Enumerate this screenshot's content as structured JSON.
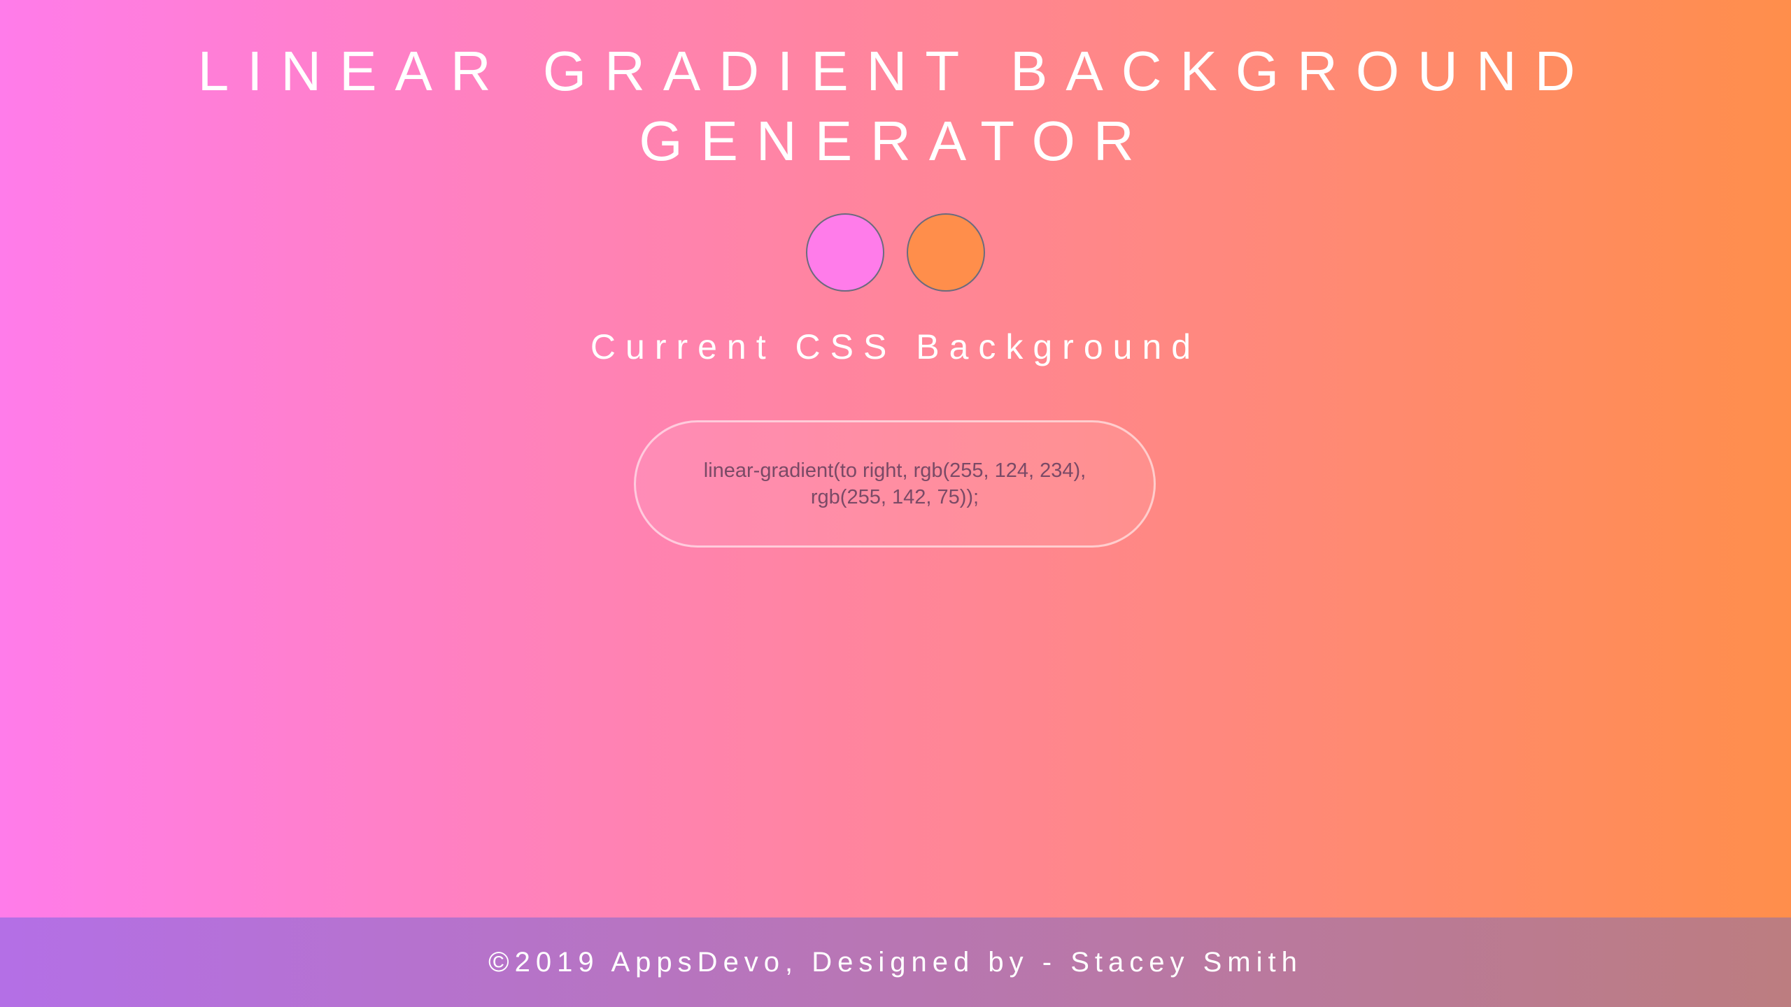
{
  "header": {
    "title_line1": "LINEAR GRADIENT BACKGROUND",
    "title_line2": "GENERATOR"
  },
  "pickers": {
    "color1": "#ff7cea",
    "color2": "#ff8e4b"
  },
  "output": {
    "label": "Current CSS Background",
    "css_text": "linear-gradient(to right, rgb(255, 124, 234), rgb(255, 142, 75));"
  },
  "footer": {
    "text": "©2019 AppsDevo, Designed by - Stacey Smith"
  }
}
